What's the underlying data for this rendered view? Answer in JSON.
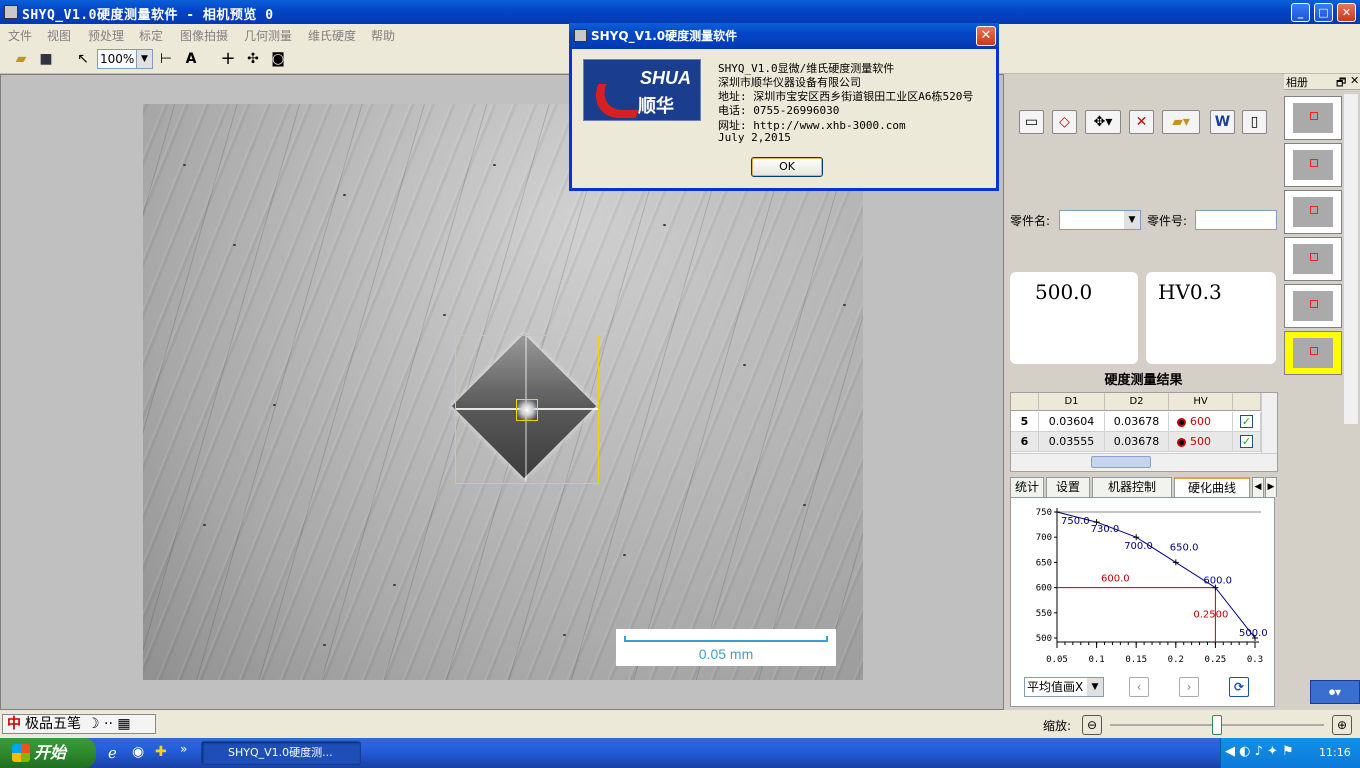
{
  "window": {
    "title": "SHYQ_V1.0硬度测量软件 - 相机预览 0"
  },
  "menu": [
    "文件",
    "视图",
    "预处理",
    "标定",
    "图像拍摄",
    "几何测量",
    "维氏硬度",
    "帮助"
  ],
  "toolbar": {
    "zoom": "100%"
  },
  "image": {
    "scale_label": "0.05 mm"
  },
  "dialog": {
    "title": "SHYQ_V1.0硬度测量软件",
    "lines": [
      "SHYQ_V1.0显微/维氏硬度测量软件",
      "深圳市顺华仪器设备有限公司",
      "地址: 深圳市宝安区西乡街道银田工业区A6栋520号",
      "电话: 0755-26996030",
      "网址: http://www.xhb-3000.com",
      "July 2,2015"
    ],
    "ok_label": "OK",
    "logo_text1": "SHUA",
    "logo_text2": "顺华"
  },
  "panel": {
    "part_name_label": "零件名:",
    "part_no_label": "零件号:",
    "load_value": "500.0",
    "scale_value": "HV0.3",
    "result_title": "硬度测量结果",
    "columns": [
      "D1",
      "D2",
      "HV"
    ],
    "rows": [
      {
        "idx": "5",
        "d1": "0.03604",
        "d2": "0.03678",
        "hv": "600"
      },
      {
        "idx": "6",
        "d1": "0.03555",
        "d2": "0.03678",
        "hv": "500"
      }
    ],
    "tabs": [
      "统计",
      "设置",
      "机器控制",
      "硬化曲线"
    ],
    "avg_select": "平均值画X"
  },
  "album": {
    "title": "相册"
  },
  "chart_data": {
    "type": "line",
    "x": [
      0.05,
      0.1,
      0.15,
      0.2,
      0.25,
      0.3
    ],
    "y": [
      750.0,
      730.0,
      700.0,
      650.0,
      600.0,
      500.0
    ],
    "point_labels": [
      "750.0",
      "730.0",
      "700.0",
      "650.0",
      "600.0",
      "500.0"
    ],
    "xticks": [
      "0.05",
      "0.1",
      "0.15",
      "0.2",
      "0.25",
      "0.3"
    ],
    "yticks": [
      "750",
      "700",
      "650",
      "600",
      "550",
      "500"
    ],
    "xlim": [
      0.05,
      0.3
    ],
    "ylim": [
      500,
      750
    ],
    "reference": {
      "y": 600.0,
      "y_label": "600.0",
      "x": 0.25,
      "x_label": "0.2500"
    },
    "line_color": "#000080",
    "ref_color": "#c00000"
  },
  "statusbar": {
    "ime_label": "极品五笔",
    "zoom_label": "缩放:"
  },
  "taskbar": {
    "start_label": "开始",
    "task_label": "SHYQ_V1.0硬度测...",
    "clock": "11:16"
  }
}
